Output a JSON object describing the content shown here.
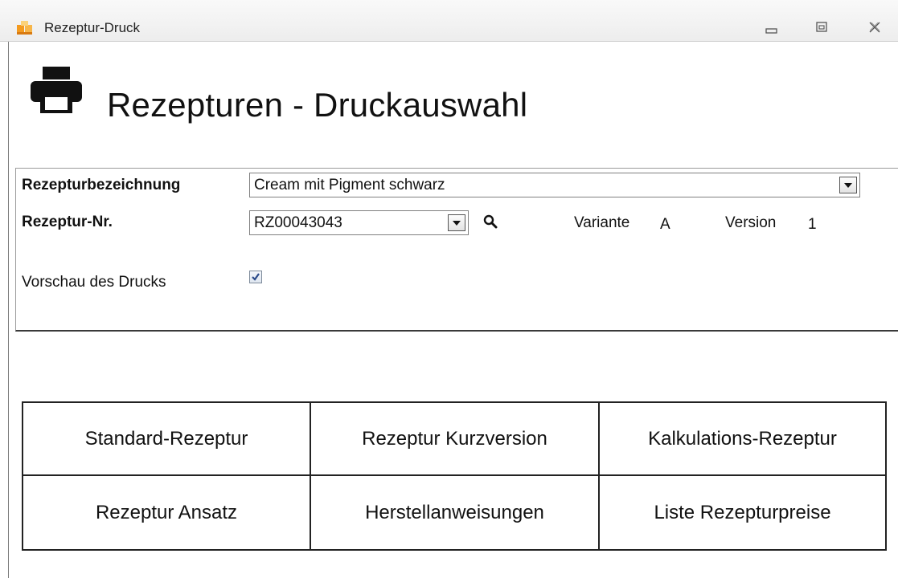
{
  "window": {
    "title": "Rezeptur-Druck",
    "controls": [
      "minimize",
      "maximize",
      "close"
    ]
  },
  "header": {
    "icon": "printer-icon",
    "title": "Rezepturen - Druckauswahl"
  },
  "form": {
    "name_label": "Rezepturbezeichnung",
    "name_value": "Cream mit Pigment schwarz",
    "number_label": "Rezeptur-Nr.",
    "number_value": "RZ00043043",
    "variant_label": "Variante",
    "variant_value": "A",
    "version_label": "Version",
    "version_value": "1",
    "preview_label": "Vorschau des Drucks",
    "preview_checked": true
  },
  "print_buttons": [
    {
      "label": "Standard-Rezeptur"
    },
    {
      "label": "Rezeptur Kurzversion"
    },
    {
      "label": "Kalkulations-Rezeptur"
    },
    {
      "label": "Rezeptur Ansatz"
    },
    {
      "label": "Herstellanweisungen"
    },
    {
      "label": "Liste Rezepturpreise"
    }
  ],
  "colors": {
    "title_bar": "#ededed",
    "app_icon_orange": "#f39a1f",
    "text": "#111111"
  }
}
